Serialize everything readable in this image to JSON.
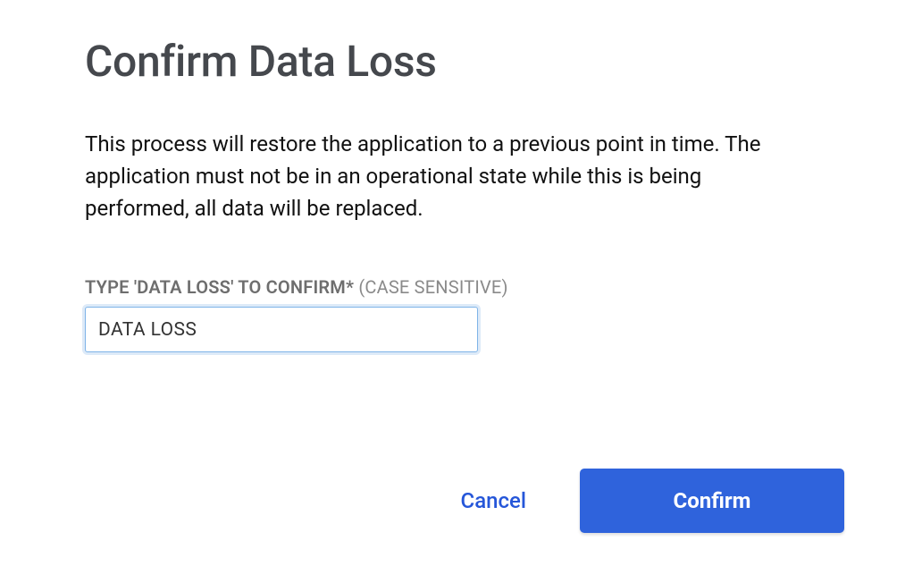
{
  "dialog": {
    "title": "Confirm Data Loss",
    "body": "This process will restore the application to a previous point in time. The application must not be in an operational state while this is being performed, all data will be replaced.",
    "field": {
      "label_bold": "TYPE 'DATA LOSS' TO CONFIRM*",
      "label_hint": "(CASE SENSITIVE)",
      "value": "DATA LOSS"
    },
    "actions": {
      "cancel": "Cancel",
      "confirm": "Confirm"
    }
  }
}
